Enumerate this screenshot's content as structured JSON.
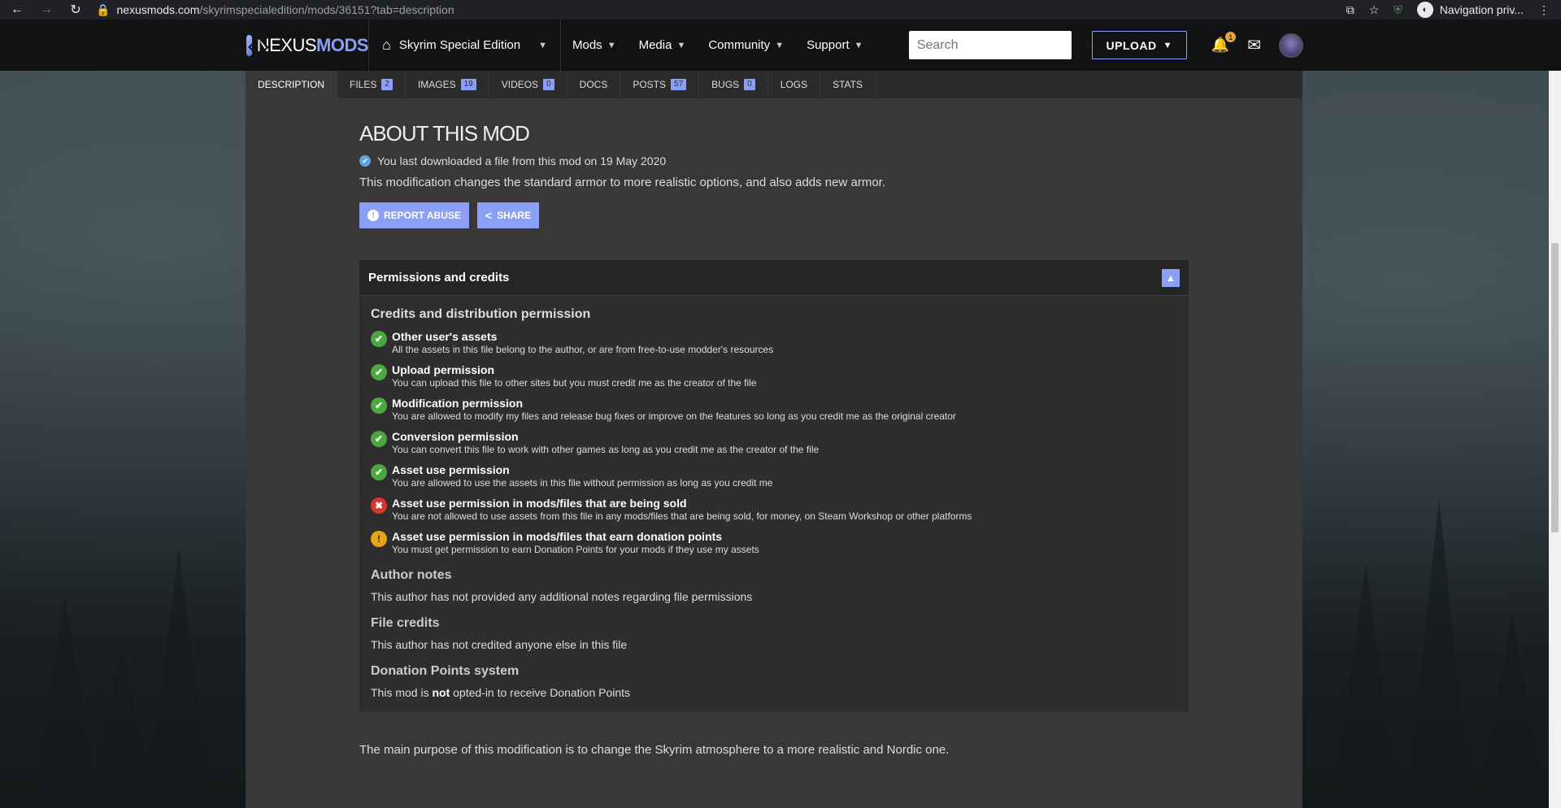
{
  "browser": {
    "url_host": "nexusmods.com",
    "url_path": "/skyrimspecialedition/mods/36151?tab=description",
    "profile_label": "Navigation priv..."
  },
  "header": {
    "logo_prefix": "NEXUS",
    "logo_suffix": "MODS",
    "game": "Skyrim Special Edition",
    "menu": [
      "Mods",
      "Media",
      "Community",
      "Support"
    ],
    "search_placeholder": "Search",
    "upload_label": "UPLOAD",
    "notification_count": "1"
  },
  "tabs": [
    {
      "label": "DESCRIPTION",
      "count": ""
    },
    {
      "label": "FILES",
      "count": "2"
    },
    {
      "label": "IMAGES",
      "count": "19"
    },
    {
      "label": "VIDEOS",
      "count": "0"
    },
    {
      "label": "DOCS",
      "count": ""
    },
    {
      "label": "POSTS",
      "count": "57"
    },
    {
      "label": "BUGS",
      "count": "0"
    },
    {
      "label": "LOGS",
      "count": ""
    },
    {
      "label": "STATS",
      "count": ""
    }
  ],
  "about": {
    "title": "ABOUT THIS MOD",
    "download_note": "You last downloaded a file from this mod on 19 May 2020",
    "summary": "This modification changes the standard armor to more realistic options, and also adds new armor.",
    "report_label": "REPORT ABUSE",
    "share_label": "SHARE"
  },
  "permissions": {
    "box_title": "Permissions and credits",
    "section_title": "Credits and distribution permission",
    "items": [
      {
        "status": "ok",
        "title": "Other user's assets",
        "desc": "All the assets in this file belong to the author, or are from free-to-use modder's resources"
      },
      {
        "status": "ok",
        "title": "Upload permission",
        "desc": "You can upload this file to other sites but you must credit me as the creator of the file"
      },
      {
        "status": "ok",
        "title": "Modification permission",
        "desc": "You are allowed to modify my files and release bug fixes or improve on the features so long as you credit me as the original creator"
      },
      {
        "status": "ok",
        "title": "Conversion permission",
        "desc": "You can convert this file to work with other games as long as you credit me as the creator of the file"
      },
      {
        "status": "ok",
        "title": "Asset use permission",
        "desc": "You are allowed to use the assets in this file without permission as long as you credit me"
      },
      {
        "status": "no",
        "title": "Asset use permission in mods/files that are being sold",
        "desc": "You are not allowed to use assets from this file in any mods/files that are being sold, for money, on Steam Workshop or other platforms"
      },
      {
        "status": "warn",
        "title": "Asset use permission in mods/files that earn donation points",
        "desc": "You must get permission to earn Donation Points for your mods if they use my assets"
      }
    ],
    "author_notes_title": "Author notes",
    "author_notes": "This author has not provided any additional notes regarding file permissions",
    "file_credits_title": "File credits",
    "file_credits": "This author has not credited anyone else in this file",
    "donation_title": "Donation Points system",
    "donation_pre": "This mod is ",
    "donation_bold": "not",
    "donation_post": " opted-in to receive Donation Points"
  },
  "main_purpose": "The main purpose of this modification is to change the Skyrim atmosphere to a more realistic and Nordic one."
}
